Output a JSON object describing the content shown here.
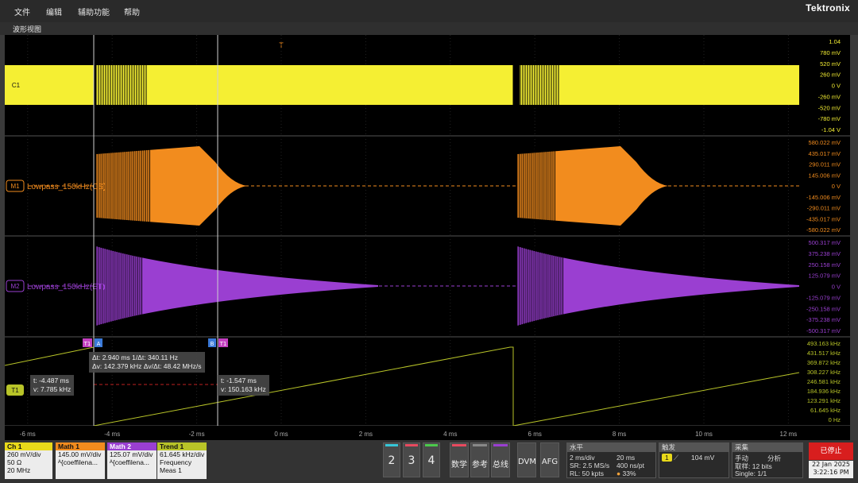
{
  "menu": [
    "文件",
    "编辑",
    "辅助功能",
    "帮助"
  ],
  "brand": "Tektronix",
  "view_title": "波形视图",
  "trigger_marker": "T",
  "pos_marker": "U",
  "colors": {
    "c1": "#f5ef33",
    "m1": "#f28c1e",
    "m2": "#9a3fd1",
    "t1": "#b8c428",
    "cursor": "#cfcfcf"
  },
  "channels": {
    "c1": {
      "tag": "C1",
      "scale": [
        "1.04",
        "780 mV",
        "520 mV",
        "260 mV",
        "0 V",
        "-260 mV",
        "-520 mV",
        "-780 mV",
        "-1.04 V"
      ]
    },
    "m1": {
      "tag": "M1",
      "label": "Lowpass_150kHz(CS)",
      "scale": [
        "580.022 mV",
        "435.017 mV",
        "290.011 mV",
        "145.006 mV",
        "0 V",
        "-145.006 mV",
        "-290.011 mV",
        "-435.017 mV",
        "-580.022 mV"
      ]
    },
    "m2": {
      "tag": "M2",
      "label": "Lowpass_150kHz(ET)",
      "scale": [
        "500.317 mV",
        "375.238 mV",
        "250.158 mV",
        "125.079 mV",
        "0 V",
        "-125.079 mV",
        "-250.158 mV",
        "-375.238 mV",
        "-500.317 mV"
      ]
    },
    "t1": {
      "tag": "T1",
      "scale": [
        "493.163 kHz",
        "431.517 kHz",
        "369.872 kHz",
        "308.227 kHz",
        "246.581 kHz",
        "184.936 kHz",
        "123.291 kHz",
        "61.645 kHz",
        "0 Hz"
      ]
    }
  },
  "time_axis": [
    "-6 ms",
    "-4 ms",
    "-2 ms",
    "0 ms",
    "2 ms",
    "4 ms",
    "6 ms",
    "8 ms",
    "10 ms",
    "12 ms"
  ],
  "cursors": {
    "a_label": "A",
    "b_label": "B",
    "t_tag": "T1",
    "delta_line1": "Δt: 2.940 ms      1/Δt: 340.11 Hz",
    "delta_line2": "Δv: 142.379 kHz   Δv/Δt: 48.42 MHz/s",
    "a_t": "t: -4.487 ms",
    "a_v": "v: 7.785 kHz",
    "b_t": "t: -1.547 ms",
    "b_v": "v: 150.163 kHz"
  },
  "badges": {
    "ch1": {
      "title": "Ch 1",
      "lines": [
        "260 mV/div",
        "50 Ω",
        "20 MHz"
      ]
    },
    "math1": {
      "title": "Math 1",
      "lines": [
        "145.00 mV/div",
        "ᴬ{coeffilena..."
      ]
    },
    "math2": {
      "title": "Math 2",
      "lines": [
        "125.07 mV/div",
        "ᴬ{coeffilena..."
      ]
    },
    "trend1": {
      "title": "Trend 1",
      "lines": [
        "61.645 kHz/div",
        "Frequency",
        "Meas 1"
      ]
    }
  },
  "buttons": {
    "b2": "2",
    "b3": "3",
    "b4": "4",
    "math": "数学",
    "ref": "参考",
    "bus": "总线",
    "dvm": "DVM",
    "afg": "AFG"
  },
  "horizontal": {
    "title": "水平",
    "scale": "2 ms/div",
    "pos": "20 ms",
    "sr": "SR: 2.5 MS/s",
    "npt": "400 ns/pt",
    "rl": "RL: 50 kpts",
    "pct": "33%"
  },
  "trigger": {
    "title": "触发",
    "src": "1",
    "level": "104 mV"
  },
  "acquisition": {
    "title": "采集",
    "mode": "手动",
    "analyze": "分析",
    "sample": "取样: 12 bits",
    "single": "Single: 1/1"
  },
  "status": {
    "stop": "已停止",
    "date": "22 Jan 2025",
    "time": "3:22:16 PM"
  }
}
